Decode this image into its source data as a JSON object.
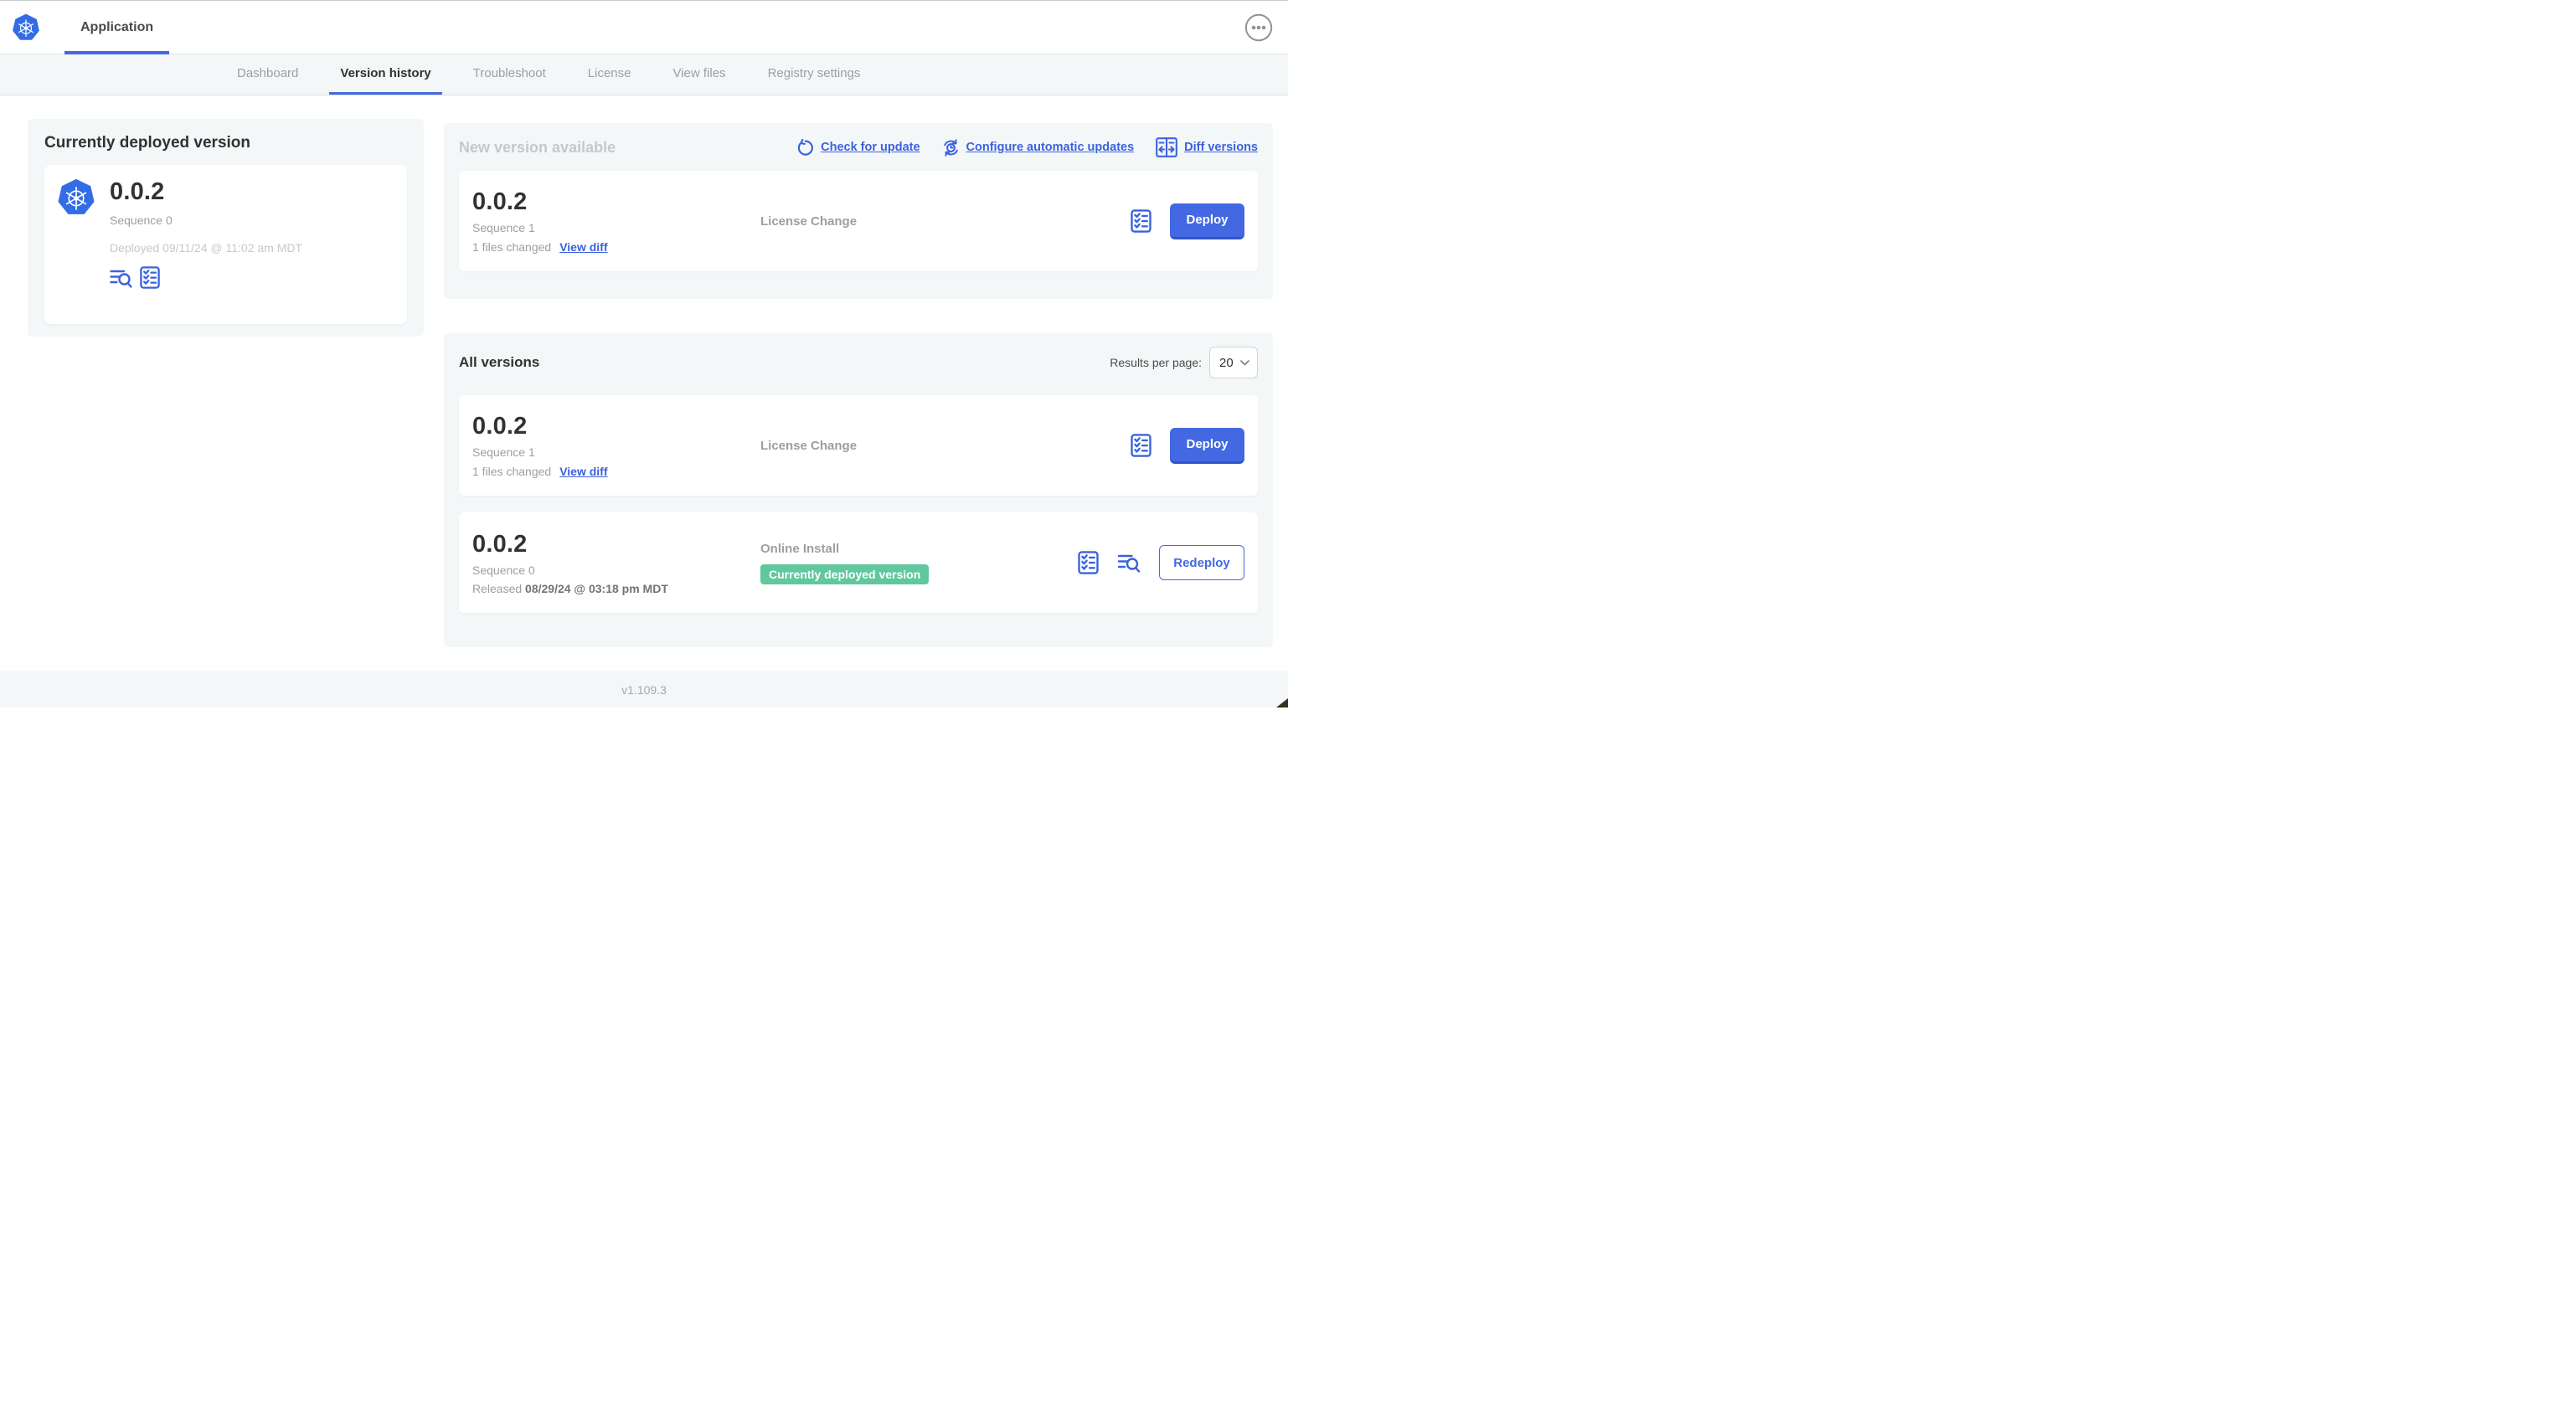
{
  "colors": {
    "accent_blue": "#4368e2",
    "link_blue": "#3b62de",
    "badge_green": "#61c79d",
    "panel_gray": "#f4f7f8",
    "logo_blue": "#326de6",
    "muted_text": "#9b9fa2",
    "faint_text": "#c4c8cb",
    "dark_text": "#323232"
  },
  "header": {
    "app_tab_label": "Application",
    "menu_icon": "ellipsis-menu-icon"
  },
  "nav": {
    "tabs": [
      {
        "label": "Dashboard",
        "active": false
      },
      {
        "label": "Version history",
        "active": true
      },
      {
        "label": "Troubleshoot",
        "active": false
      },
      {
        "label": "License",
        "active": false
      },
      {
        "label": "View files",
        "active": false
      },
      {
        "label": "Registry settings",
        "active": false
      }
    ]
  },
  "currently_deployed": {
    "title": "Currently deployed version",
    "version": "0.0.2",
    "sequence": "Sequence 0",
    "deployed_text": "Deployed 09/11/24 @ 11:02 am MDT",
    "icons": [
      "view-logs-icon",
      "preflight-checks-icon"
    ]
  },
  "new_version": {
    "title": "New version available",
    "actions": [
      {
        "label": "Check for update",
        "icon": "refresh-icon"
      },
      {
        "label": "Configure automatic updates",
        "icon": "auto-update-clock-icon"
      },
      {
        "label": "Diff versions",
        "icon": "diff-icon"
      }
    ],
    "row": {
      "version": "0.0.2",
      "sequence": "Sequence 1",
      "files_changed": "1 files changed",
      "view_diff_label": "View diff",
      "source": "License Change",
      "deploy_label": "Deploy"
    }
  },
  "all_versions": {
    "title": "All versions",
    "results_per_page_label": "Results per page:",
    "results_per_page_value": "20",
    "rows": [
      {
        "version": "0.0.2",
        "sequence": "Sequence 1",
        "files_changed": "1 files changed",
        "view_diff_label": "View diff",
        "source": "License Change",
        "action_label": "Deploy"
      },
      {
        "version": "0.0.2",
        "sequence": "Sequence 0",
        "released_prefix": "Released ",
        "released_date": "08/29/24 @ 03:18 pm MDT",
        "source": "Online Install",
        "badge": "Currently deployed version",
        "action_label": "Redeploy"
      }
    ]
  },
  "footer": {
    "version": "v1.109.3"
  }
}
